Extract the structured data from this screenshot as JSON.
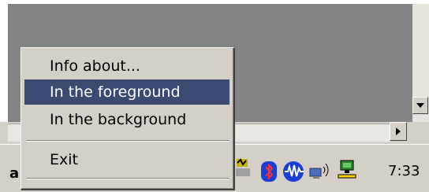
{
  "context_menu": {
    "items": [
      {
        "label": "Info about...",
        "highlighted": false
      },
      {
        "label": "In the foreground",
        "highlighted": true
      },
      {
        "label": "In the background",
        "highlighted": false
      },
      {
        "label": "Exit",
        "highlighted": false
      }
    ]
  },
  "taskbar": {
    "partial_button_text": "a",
    "clock": "7:33",
    "tray_icons": [
      "bluetooth-icon",
      "audio-wave-icon",
      "wireless-network-icon",
      "network-computer-icon",
      "partial-tray-icon"
    ]
  },
  "colors": {
    "desktop_gray": "#848484",
    "menu_face": "#d4d0c8",
    "menu_highlight": "#3a4a72",
    "bluetooth_blue": "#1a3fd6"
  }
}
